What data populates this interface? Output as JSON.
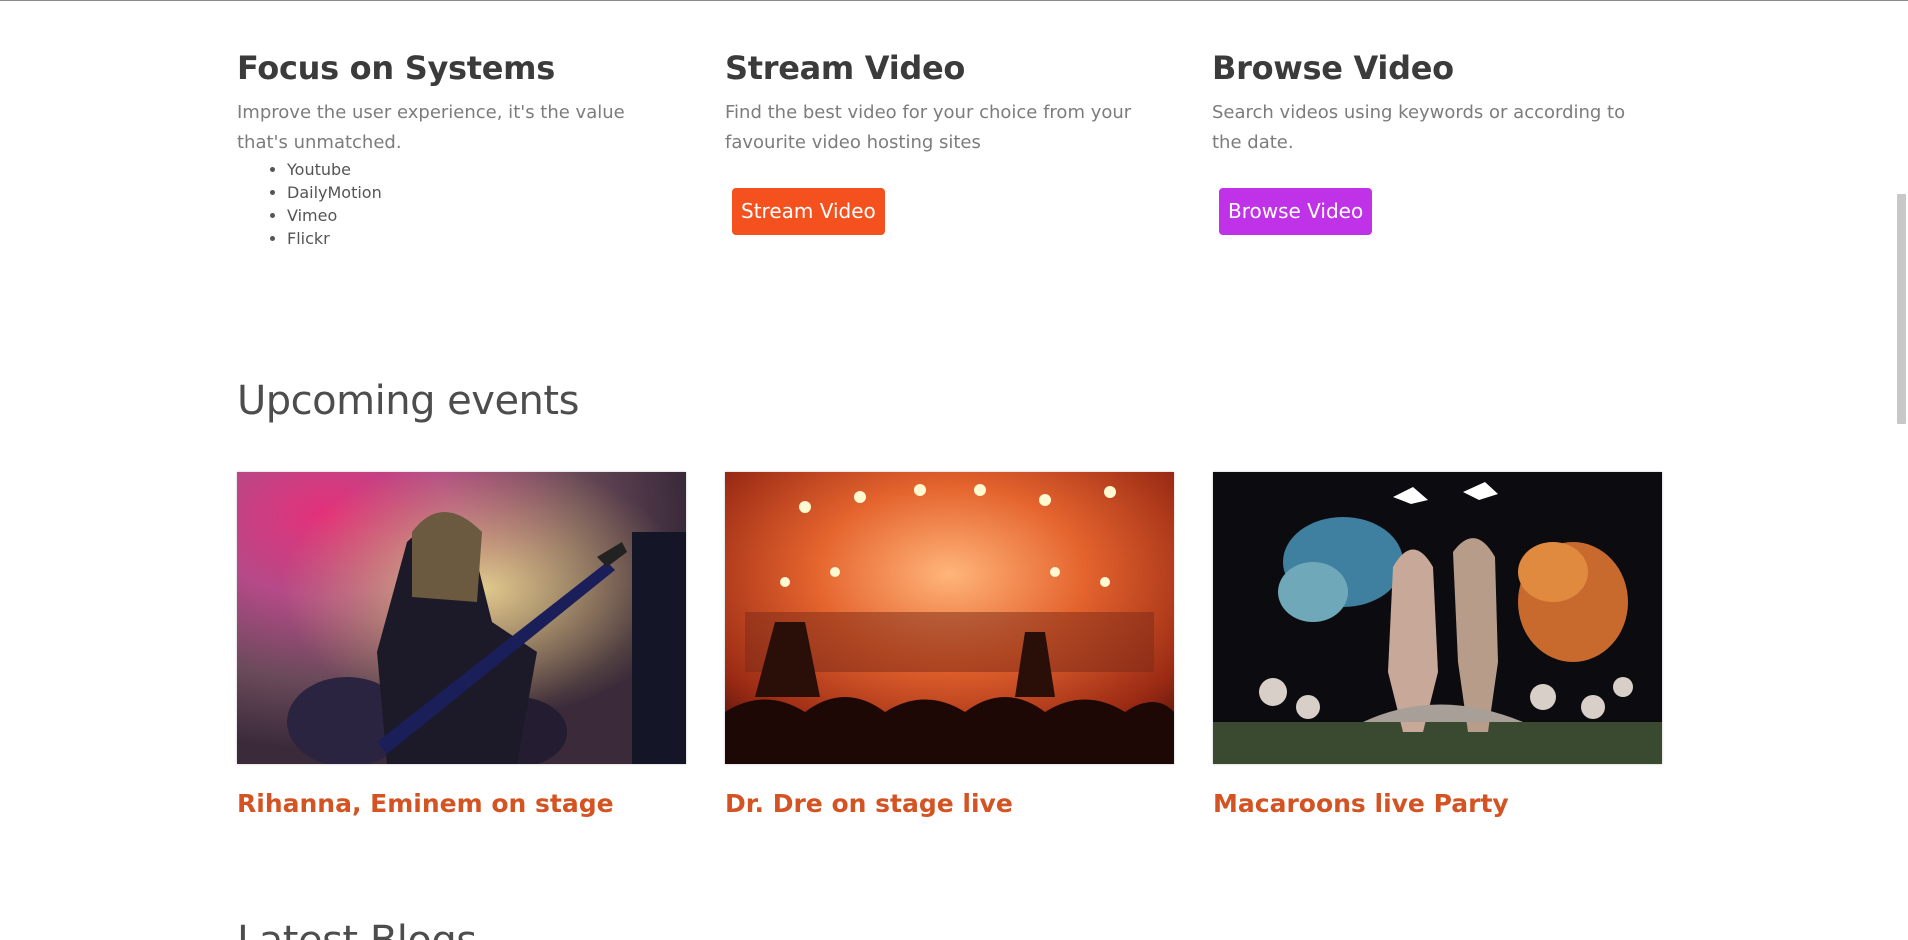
{
  "features": [
    {
      "title": "Focus on Systems",
      "description": "Improve the user experience, it's the value that's unmatched.",
      "list": [
        "Youtube",
        "DailyMotion",
        "Vimeo",
        "Flickr"
      ]
    },
    {
      "title": "Stream Video",
      "description": "Find the best video for your choice from your favourite video hosting sites",
      "button_label": "Stream Video",
      "button_color": "#f5511e"
    },
    {
      "title": "Browse Video",
      "description": "Search videos using keywords or according to the date.",
      "button_label": "Browse Video",
      "button_color": "#c032e8"
    }
  ],
  "events_section": {
    "title": "Upcoming events",
    "events": [
      {
        "caption": "Rihanna, Eminem on stage",
        "image": "concert-guitarist-photo"
      },
      {
        "caption": "Dr. Dre on stage live",
        "image": "stage-lights-concert-photo"
      },
      {
        "caption": "Macaroons live Party",
        "image": "festival-sculpture-photo"
      }
    ]
  },
  "blogs_section": {
    "title": "Latest Blogs"
  },
  "colors": {
    "heading": "#3b3b3b",
    "body_text": "#7c7c7c",
    "event_caption": "#d35322"
  }
}
